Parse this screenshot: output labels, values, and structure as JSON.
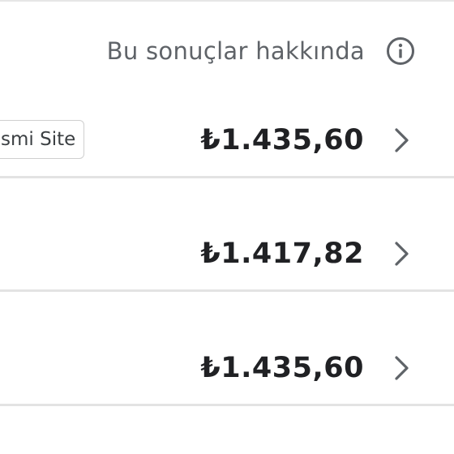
{
  "header": {
    "about_results_label": "Bu sonuçlar hakkında",
    "info_icon": "info-circle-icon"
  },
  "offers": [
    {
      "badge": "smi Site",
      "price": "₺1.435,60",
      "chevron_icon": "chevron-right-icon"
    },
    {
      "badge": "",
      "price": "₺1.417,82",
      "chevron_icon": "chevron-right-icon"
    },
    {
      "badge": "",
      "price": "₺1.435,60",
      "chevron_icon": "chevron-right-icon"
    }
  ],
  "colors": {
    "text_secondary": "#5f6368",
    "text_primary": "#202124",
    "divider": "#e3e3e3",
    "badge_border": "#cfcfcf"
  }
}
